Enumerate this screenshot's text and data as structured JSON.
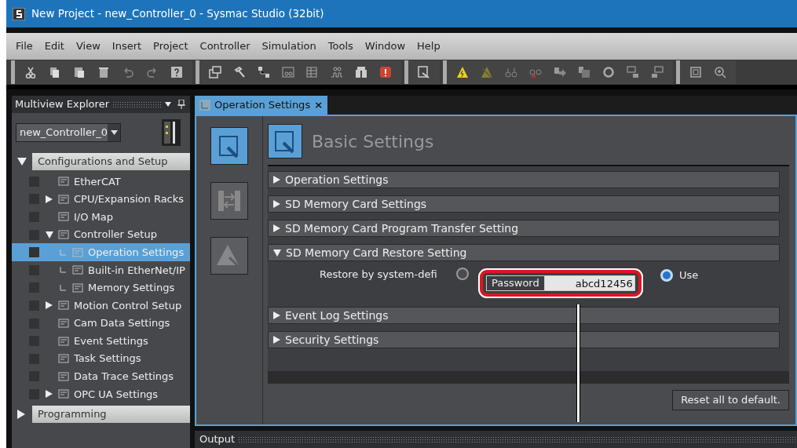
{
  "window": {
    "title": "New Project - new_Controller_0 - Sysmac Studio (32bit)"
  },
  "menu": [
    "File",
    "Edit",
    "View",
    "Insert",
    "Project",
    "Controller",
    "Simulation",
    "Tools",
    "Window",
    "Help"
  ],
  "explorer": {
    "title": "Multiview Explorer",
    "controller": "new_Controller_0",
    "sections": [
      {
        "label": "Configurations and Setup",
        "expanded": true,
        "children": [
          {
            "label": "EtherCAT",
            "selected": false
          },
          {
            "label": "CPU/Expansion Racks",
            "selected": false,
            "expanded": false
          },
          {
            "label": "I/O Map",
            "selected": false
          },
          {
            "label": "Controller Setup",
            "selected": false,
            "expanded": true,
            "children": [
              {
                "label": "Operation Settings",
                "selected": true
              },
              {
                "label": "Built-in EtherNet/IP",
                "selected": false
              },
              {
                "label": "Memory Settings",
                "selected": false
              }
            ]
          },
          {
            "label": "Motion Control Setup",
            "selected": false,
            "expanded": false
          },
          {
            "label": "Cam Data Settings",
            "selected": false
          },
          {
            "label": "Event Settings",
            "selected": false
          },
          {
            "label": "Task Settings",
            "selected": false
          },
          {
            "label": "Data Trace Settings",
            "selected": false
          },
          {
            "label": "OPC UA Settings",
            "selected": false,
            "expanded": false
          }
        ]
      },
      {
        "label": "Programming",
        "expanded": false
      }
    ]
  },
  "editor": {
    "tab": {
      "label": "Operation Settings",
      "close": "×"
    },
    "side_buttons": [
      {
        "selected": true
      },
      {
        "selected": false
      },
      {
        "selected": false
      }
    ],
    "heading": "Basic Settings",
    "sections": [
      {
        "label": "Operation Settings",
        "expanded": false
      },
      {
        "label": "SD Memory Card Settings",
        "expanded": false
      },
      {
        "label": "SD Memory Card Program Transfer Setting",
        "expanded": false
      },
      {
        "label": "SD Memory Card Restore Setting",
        "expanded": true,
        "setting": {
          "label": "Restore by system-defi",
          "options": [
            {
              "selected": false
            },
            {
              "label": "Use",
              "selected": true
            }
          ],
          "password": {
            "label": "Password",
            "value": "abcd12456"
          }
        }
      },
      {
        "label": "Event Log Settings",
        "expanded": false
      },
      {
        "label": "Security Settings",
        "expanded": false
      }
    ],
    "reset_button": "Reset all to default."
  },
  "output": {
    "title": "Output"
  }
}
